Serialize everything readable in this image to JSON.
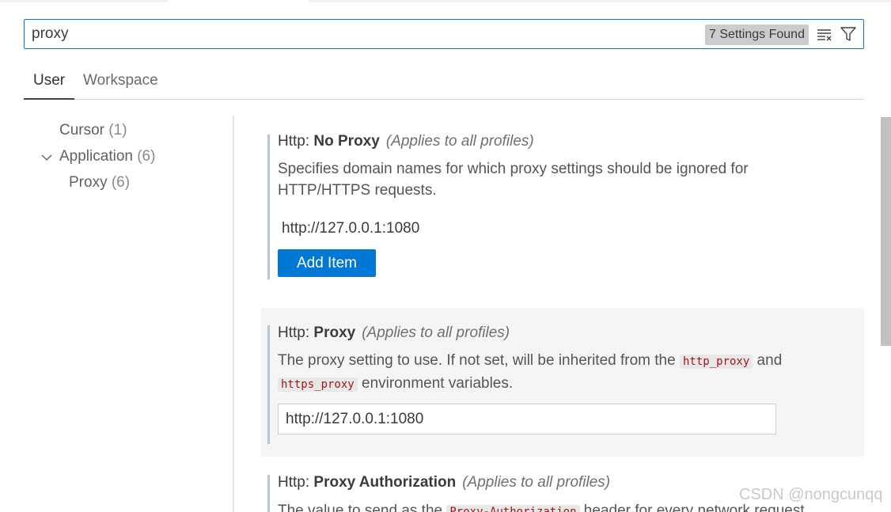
{
  "search": {
    "value": "proxy",
    "results_badge": "7 Settings Found",
    "clear_icon": "clear-filter-icon",
    "filter_icon": "funnel-filter-icon"
  },
  "tabs": [
    {
      "label": "User",
      "active": true
    },
    {
      "label": "Workspace",
      "active": false
    }
  ],
  "toc": {
    "items": [
      {
        "label": "Cursor",
        "count": "(1)"
      },
      {
        "label": "Application",
        "count": "(6)",
        "expanded": true,
        "icon": "chevron-down-icon"
      },
      {
        "label": "Proxy",
        "count": "(6)"
      }
    ]
  },
  "settings": [
    {
      "category": "Http: ",
      "name": "No Proxy",
      "scope": "(Applies to all profiles)",
      "description": "Specifies domain names for which proxy settings should be ignored for HTTP/HTTPS requests.",
      "list_items": [
        "http://127.0.0.1:1080"
      ],
      "add_button": "Add Item"
    },
    {
      "category": "Http: ",
      "name": "Proxy",
      "scope": "(Applies to all profiles)",
      "desc_part1": "The proxy setting to use. If not set, will be inherited from the ",
      "code1": "http_proxy",
      "desc_part2": " and ",
      "code2": "https_proxy",
      "desc_part3": " environment variables.",
      "value": "http://127.0.0.1:1080"
    },
    {
      "category": "Http: ",
      "name": "Proxy Authorization",
      "scope": "(Applies to all profiles)",
      "desc_part1": "The value to send as the ",
      "code1": "Proxy-Authorization",
      "desc_part2": " header for every network request."
    }
  ],
  "watermark": "CSDN @nongcunqq",
  "colors": {
    "accent": "#0078d4",
    "focused_bg": "#f5f5f5",
    "code_fg": "#a31515"
  }
}
